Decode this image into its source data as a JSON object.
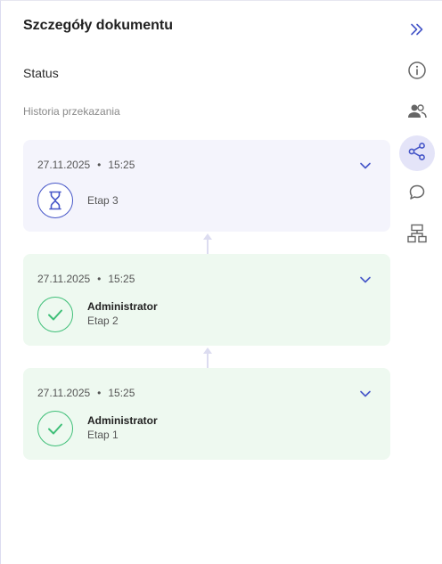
{
  "panel": {
    "title": "Szczegóły dokumentu",
    "status_label": "Status",
    "history_label": "Historia przekazania"
  },
  "history": [
    {
      "date": "27.11.2025",
      "separator": "•",
      "time": "15:25",
      "stage": "Etap 3",
      "state": "pending",
      "state_icon": "hourglass-icon"
    },
    {
      "date": "27.11.2025",
      "separator": "•",
      "time": "15:25",
      "who": "Administrator",
      "stage": "Etap 2",
      "state": "done",
      "state_icon": "check-icon"
    },
    {
      "date": "27.11.2025",
      "separator": "•",
      "time": "15:25",
      "who": "Administrator",
      "stage": "Etap 1",
      "state": "done",
      "state_icon": "check-icon"
    }
  ],
  "rail": [
    {
      "icon": "double-chevron-right-icon",
      "active": false
    },
    {
      "icon": "info-icon",
      "active": false
    },
    {
      "icon": "users-icon",
      "active": false
    },
    {
      "icon": "share-icon",
      "active": true
    },
    {
      "icon": "comment-icon",
      "active": false
    },
    {
      "icon": "hierarchy-icon",
      "active": false
    }
  ],
  "colors": {
    "accent": "#4656c8",
    "pending_bg": "#f4f4fc",
    "done_bg": "#eef9f0",
    "done_green": "#3fbf78",
    "rail_active_bg": "#e4e4f8"
  }
}
